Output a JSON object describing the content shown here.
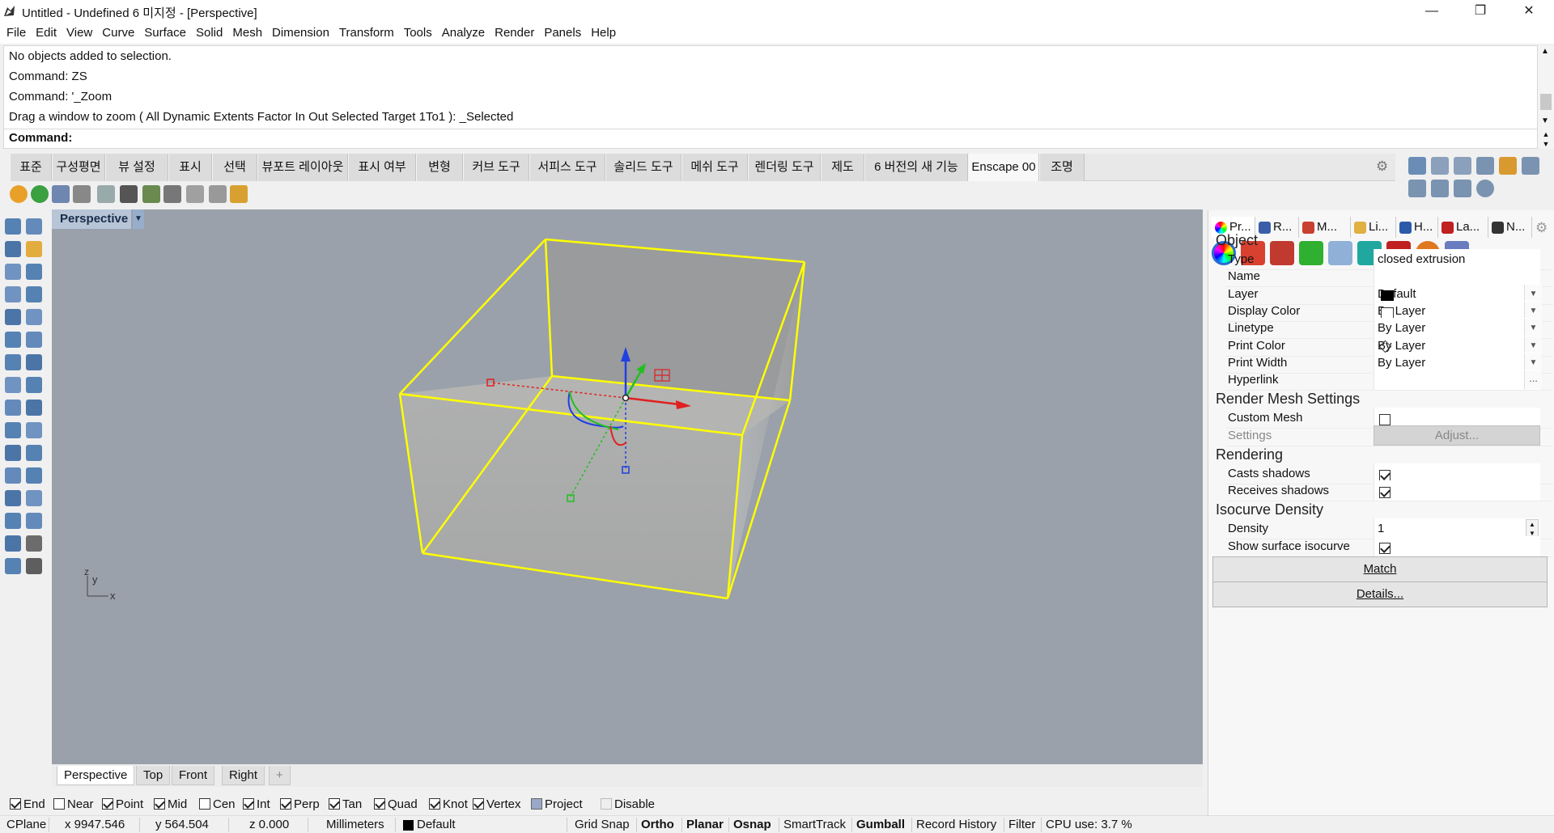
{
  "window": {
    "title": "Untitled - Undefined 6 미지정 - [Perspective]",
    "minimize": "—",
    "maximize": "❐",
    "close": "✕"
  },
  "menu": [
    "File",
    "Edit",
    "View",
    "Curve",
    "Surface",
    "Solid",
    "Mesh",
    "Dimension",
    "Transform",
    "Tools",
    "Analyze",
    "Render",
    "Panels",
    "Help"
  ],
  "history": [
    "No objects added to selection.",
    "Command: ZS",
    "Command: '_Zoom",
    "Drag a window to zoom ( All  Dynamic  Extents  Factor  In  Out  Selected  Target  1To1 ): _Selected"
  ],
  "command_label": "Command:",
  "toolbar_tabs": [
    "표준",
    "구성평면",
    "뷰 설정",
    "표시",
    "선택",
    "뷰포트 레이아웃",
    "표시 여부",
    "변형",
    "커브 도구",
    "서피스 도구",
    "솔리드 도구",
    "메쉬 도구",
    "렌더링 도구",
    "제도",
    "6 버전의 새 기능",
    "Enscape 00",
    "조명"
  ],
  "active_toolbar_tab": "Enscape 00",
  "viewport": {
    "title": "Perspective",
    "axis_y": "y",
    "axis_z": "z",
    "axis_x": "x"
  },
  "viewport_tabs": [
    "Perspective",
    "Top",
    "Front",
    "Right"
  ],
  "viewport_add": "+",
  "osnaps": [
    {
      "label": "End",
      "checked": true
    },
    {
      "label": "Near",
      "checked": false
    },
    {
      "label": "Point",
      "checked": true
    },
    {
      "label": "Mid",
      "checked": true
    },
    {
      "label": "Cen",
      "checked": false
    },
    {
      "label": "Int",
      "checked": true
    },
    {
      "label": "Perp",
      "checked": true
    },
    {
      "label": "Tan",
      "checked": true
    },
    {
      "label": "Quad",
      "checked": true
    },
    {
      "label": "Knot",
      "checked": true
    },
    {
      "label": "Vertex",
      "checked": true
    },
    {
      "label": "Project",
      "checked": false
    },
    {
      "label": "Disable",
      "checked": false
    }
  ],
  "status": {
    "cplane": "CPlane",
    "x": "x 9947.546",
    "y": "y 564.504",
    "z": "z 0.000",
    "units": "Millimeters",
    "layer": "Default",
    "toggles": [
      "Grid Snap",
      "Ortho",
      "Planar",
      "Osnap",
      "SmartTrack",
      "Gumball",
      "Record History",
      "Filter"
    ],
    "bold_toggles": [
      "Ortho",
      "Planar",
      "Osnap",
      "Gumball"
    ],
    "cpu": "CPU use: 3.7 %"
  },
  "panel": {
    "tabs": [
      "Pr...",
      "R...",
      "M...",
      "Li...",
      "H...",
      "La...",
      "N..."
    ],
    "object_title": "Object",
    "rows": [
      {
        "k": "Type",
        "v": "closed extrusion"
      },
      {
        "k": "Name",
        "v": ""
      },
      {
        "k": "Layer",
        "v": "Default"
      },
      {
        "k": "Display Color",
        "v": "By Layer"
      },
      {
        "k": "Linetype",
        "v": "By Layer"
      },
      {
        "k": "Print Color",
        "v": "By Layer"
      },
      {
        "k": "Print Width",
        "v": "By Layer"
      },
      {
        "k": "Hyperlink",
        "v": ""
      }
    ],
    "hyperlink_btn": "...",
    "mesh_title": "Render Mesh Settings",
    "custom_mesh": "Custom Mesh",
    "settings": "Settings",
    "adjust": "Adjust...",
    "rendering_title": "Rendering",
    "casts_shadows": "Casts shadows",
    "receives_shadows": "Receives shadows",
    "iso_title": "Isocurve Density",
    "density": "Density",
    "density_value": "1",
    "show_iso": "Show surface isocurve",
    "match": "Match",
    "details": "Details..."
  },
  "colors": {
    "selection": "#ffff00",
    "viewport_bg": "#9aa1ab",
    "gumball_x": "#e02020",
    "gumball_y": "#20c020",
    "gumball_z": "#2040e0"
  }
}
